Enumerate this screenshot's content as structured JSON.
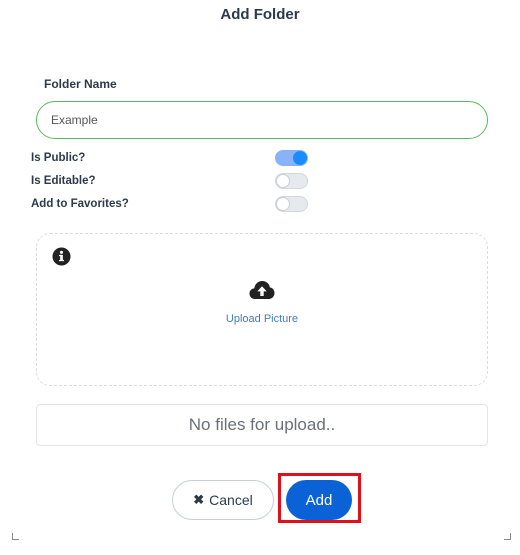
{
  "dialog": {
    "title": "Add Folder"
  },
  "form": {
    "folder_name_label": "Folder Name",
    "folder_name_value": "Example",
    "toggles": [
      {
        "label": "Is Public?",
        "checked": true
      },
      {
        "label": "Is Editable?",
        "checked": false
      },
      {
        "label": "Add to Favorites?",
        "checked": false
      }
    ]
  },
  "upload": {
    "info_icon": "info-circle-icon",
    "upload_icon": "cloud-upload-icon",
    "label": "Upload Picture",
    "empty_message": "No files for upload.."
  },
  "actions": {
    "cancel_icon": "times-icon",
    "cancel_label": "Cancel",
    "add_label": "Add"
  },
  "colors": {
    "accent": "#0b62d6",
    "toggle_on": "#1a8cff",
    "input_border": "#5cb85c",
    "highlight": "#e0101b"
  }
}
